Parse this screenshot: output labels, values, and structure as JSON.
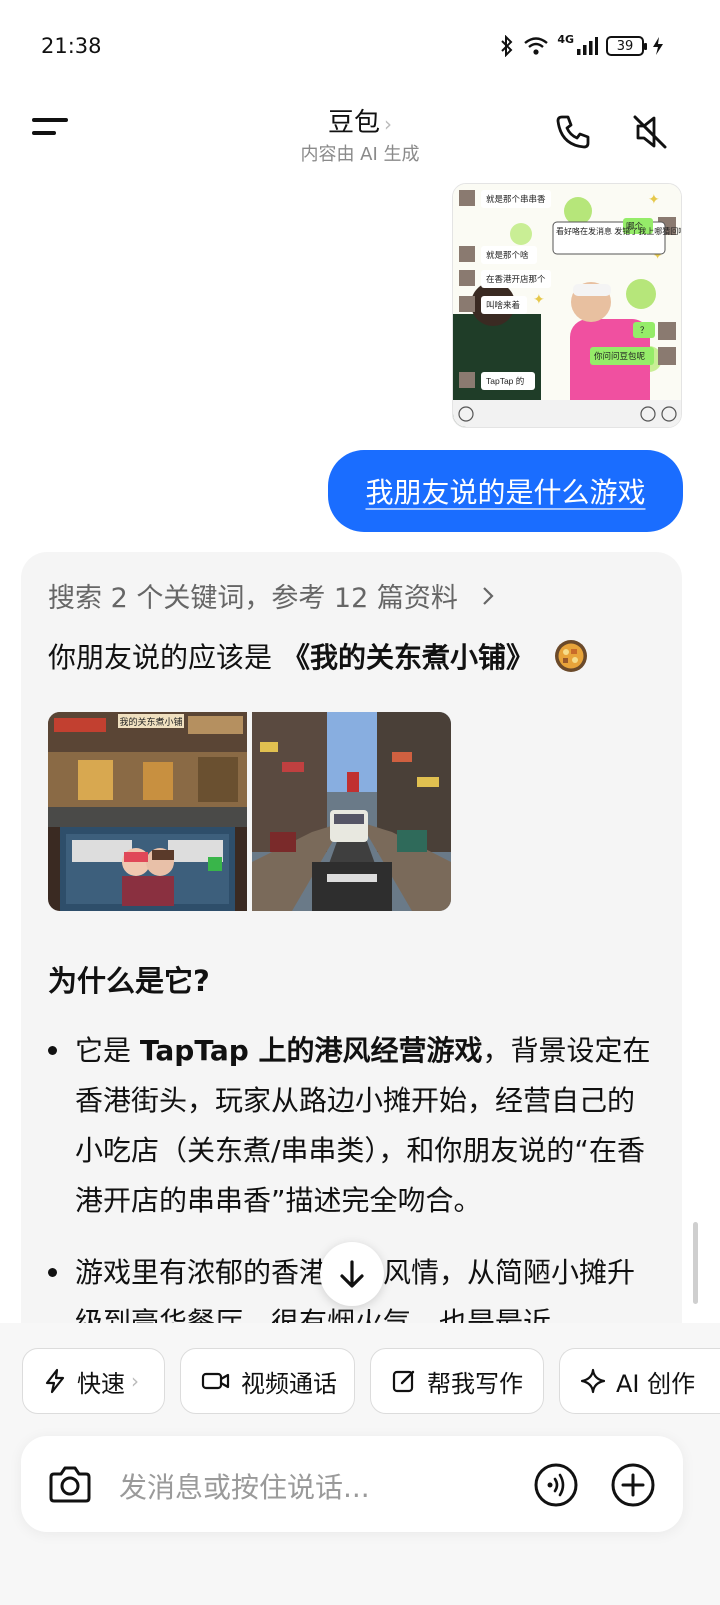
{
  "status_bar": {
    "time": "21:38",
    "battery": "39",
    "network": "4G"
  },
  "header": {
    "title": "豆包",
    "subtitle": "内容由 AI 生成"
  },
  "screenshot_msg": {
    "chat_lines": [
      "就是那个串串香",
      "看好咯在发消息 发错了我上哪猜回啊",
      "哪个",
      "就是那个啥",
      "在香港开店那个",
      "叫啥来着",
      "？",
      "你问问豆包呢",
      "TapTap 的"
    ]
  },
  "user_message": {
    "text": "我朋友说的是什么游戏"
  },
  "ai_reply": {
    "search_summary": "搜索 2 个关键词，参考 12 篇资料",
    "answer_prefix": "你朋友说的应该是",
    "game_name": "《我的关东煮小铺》",
    "image1_sign": "我的关东煮小铺",
    "why_title": "为什么是它?",
    "bullet1": {
      "pre": "它是 ",
      "bold": "TapTap 上的港风经营游戏",
      "rest": "，背景设定在香港街头，玩家从路边小摊开始，经营自己的小吃店（关东煮/串串类），和你朋友说的“在香港开店的串串香”描述完全吻合。"
    },
    "bullet2": {
      "text": "游戏里有浓郁的香港市井风情，从简陋小摊升级到豪华餐厅，很有烟火气，也是最近"
    }
  },
  "quick_actions": [
    "快速",
    "视频通话",
    "帮我写作",
    "AI 创作"
  ],
  "input": {
    "placeholder": "发消息或按住说话..."
  },
  "colors": {
    "accent": "#1a6dff",
    "card_bg": "#f5f5f5"
  }
}
